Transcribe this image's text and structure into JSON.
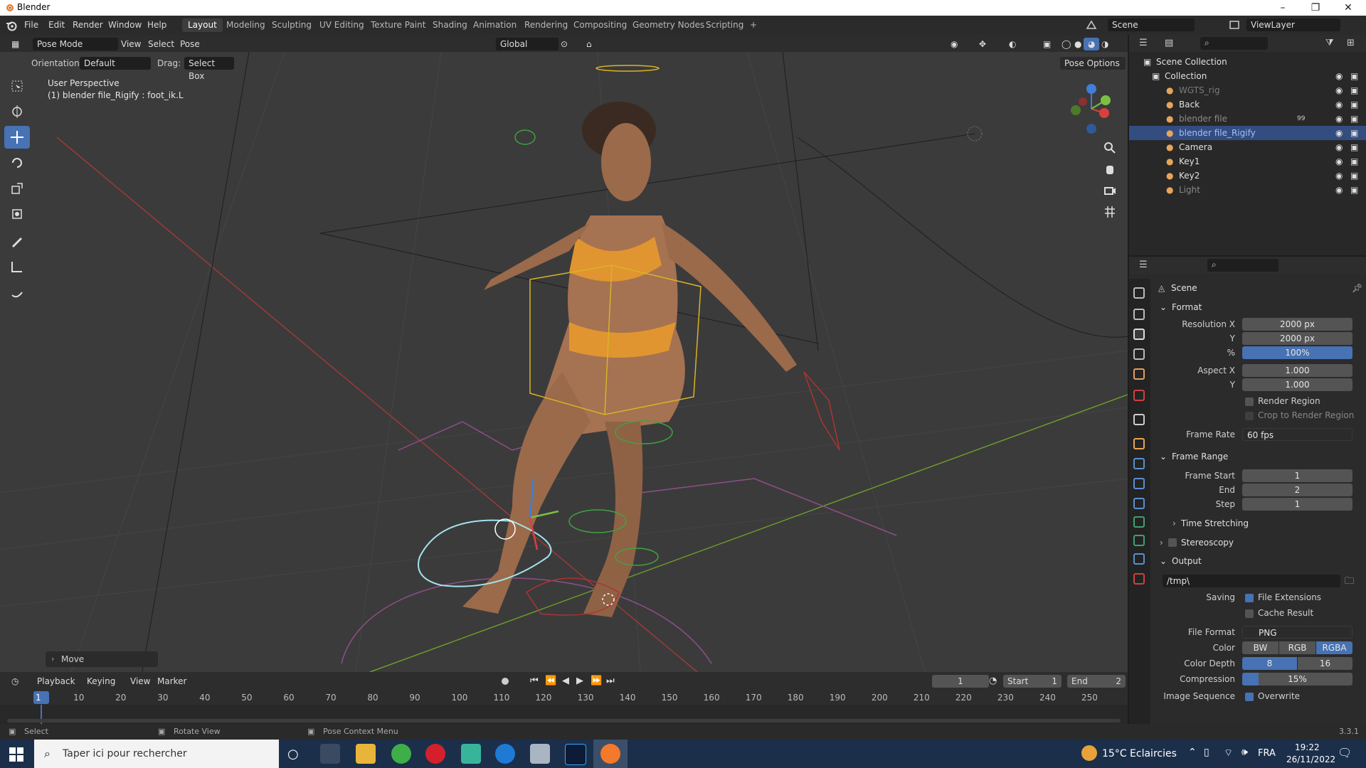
{
  "window": {
    "title": "Blender",
    "minimize": "–",
    "maximize": "❐",
    "close": "✕"
  },
  "menu": {
    "items": [
      "File",
      "Edit",
      "Render",
      "Window",
      "Help"
    ]
  },
  "workspaces": {
    "tabs": [
      "Layout",
      "Modeling",
      "Sculpting",
      "UV Editing",
      "Texture Paint",
      "Shading",
      "Animation",
      "Rendering",
      "Compositing",
      "Geometry Nodes",
      "Scripting"
    ],
    "add": "+"
  },
  "scene_selector": {
    "scene": "Scene",
    "view_layer": "ViewLayer"
  },
  "viewport_header": {
    "mode": "Pose Mode",
    "menus": [
      "View",
      "Select",
      "Pose"
    ],
    "transform": "Global",
    "orientation_label": "Orientation:",
    "orientation_value": "Default",
    "drag_label": "Drag:",
    "drag_value": "Select Box",
    "pose_options": "Pose Options"
  },
  "viewport": {
    "perspective": "User Perspective",
    "active_info": "(1) blender file_Rigify : foot_ik.L",
    "last_op": "Move"
  },
  "outliner": {
    "items": [
      {
        "label": "Scene Collection",
        "color": "#e0e0e0"
      },
      {
        "label": "Collection",
        "color": "#e0e0e0"
      },
      {
        "label": "WGTS_rig",
        "color": "#7a7a7a"
      },
      {
        "label": "Back",
        "color": "#e0e0e0"
      },
      {
        "label": "blender file",
        "color": "#8a8a8a",
        "badge": "99"
      },
      {
        "label": "blender file_Rigify",
        "color": "#9fc0ff"
      },
      {
        "label": "Camera",
        "color": "#e0e0e0"
      },
      {
        "label": "Key1",
        "color": "#e0e0e0"
      },
      {
        "label": "Key2",
        "color": "#e0e0e0"
      },
      {
        "label": "Light",
        "color": "#8a8a8a"
      }
    ]
  },
  "properties": {
    "context": "Scene",
    "format": {
      "title": "Format",
      "resolution_x_label": "Resolution X",
      "resolution_x": "2000 px",
      "y_label": "Y",
      "resolution_y": "2000 px",
      "pct_label": "%",
      "pct": "100%",
      "aspect_x_label": "Aspect X",
      "aspect_x": "1.000",
      "aspect_y_label": "Y",
      "aspect_y": "1.000",
      "render_region": "Render Region",
      "crop": "Crop to Render Region",
      "frame_rate_label": "Frame Rate",
      "frame_rate": "60 fps"
    },
    "frame_range": {
      "title": "Frame Range",
      "start_label": "Frame Start",
      "start": "1",
      "end_label": "End",
      "end": "2",
      "step_label": "Step",
      "step": "1"
    },
    "time_stretching": "Time Stretching",
    "stereoscopy": "Stereoscopy",
    "output": {
      "title": "Output",
      "path": "/tmp\\",
      "saving_label": "Saving",
      "file_extensions": "File Extensions",
      "cache_result": "Cache Result",
      "file_format_label": "File Format",
      "file_format": "PNG",
      "color_label": "Color",
      "color_opts": [
        "BW",
        "RGB",
        "RGBA"
      ],
      "color_depth_label": "Color Depth",
      "depth_opts": [
        "8",
        "16"
      ],
      "compression_label": "Compression",
      "compression": "15%",
      "image_sequence_label": "Image Sequence",
      "overwrite": "Overwrite"
    },
    "version": "3.3.1"
  },
  "timeline": {
    "menus": [
      "Playback",
      "Keying",
      "View",
      "Marker"
    ],
    "current_frame": "1",
    "start_label": "Start",
    "start": "1",
    "end_label": "End",
    "end": "2",
    "ticks": [
      "1",
      "10",
      "20",
      "30",
      "40",
      "50",
      "60",
      "70",
      "80",
      "90",
      "100",
      "110",
      "120",
      "130",
      "140",
      "150",
      "160",
      "170",
      "180",
      "190",
      "200",
      "210",
      "220",
      "230",
      "240",
      "250"
    ]
  },
  "status": {
    "select": "Select",
    "rotate": "Rotate View",
    "context": "Pose Context Menu"
  },
  "taskbar": {
    "search_placeholder": "Taper ici pour rechercher",
    "weather": "15°C  Eclaircies",
    "lang": "FRA",
    "time": "19:22",
    "date": "26/11/2022"
  }
}
